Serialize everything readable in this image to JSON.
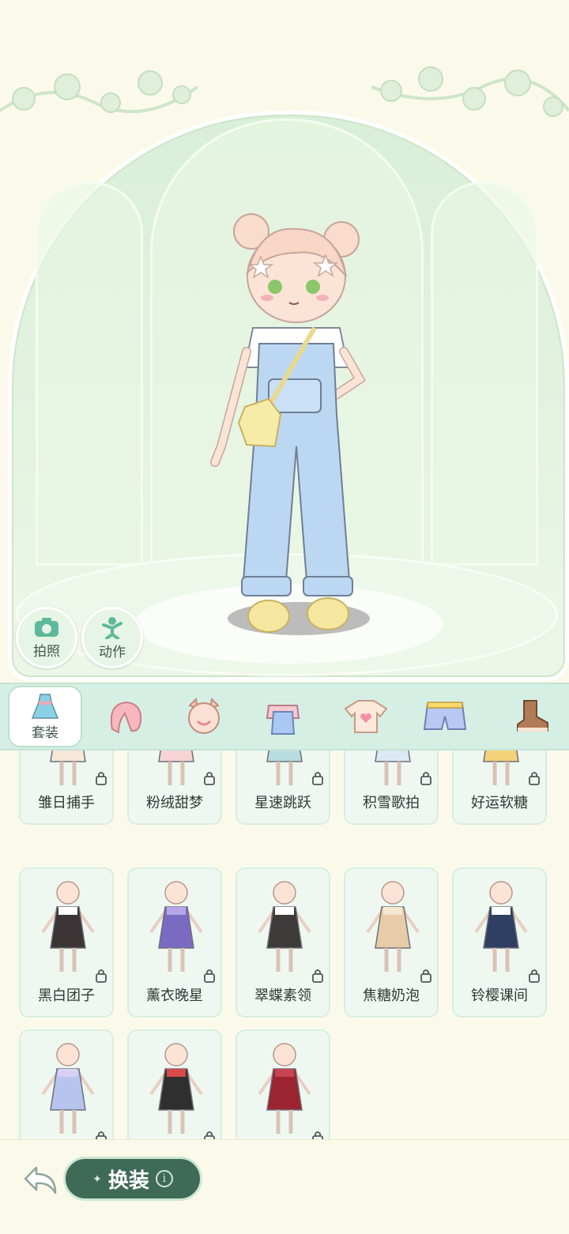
{
  "stage": {
    "photo_button_label": "拍照",
    "action_button_label": "动作"
  },
  "tabs": {
    "active_label": "套装",
    "icons": [
      "dress-icon",
      "hair-icon",
      "face-icon",
      "overalls-icon",
      "tshirt-icon",
      "shorts-icon",
      "shoe-icon"
    ]
  },
  "outfits": [
    {
      "name": "雏日捕手",
      "locked": true,
      "colors": [
        "#f6e7d8",
        "#ffffff"
      ]
    },
    {
      "name": "粉绒甜梦",
      "locked": true,
      "colors": [
        "#f7d3d6",
        "#ffffff"
      ]
    },
    {
      "name": "星速跳跃",
      "locked": true,
      "colors": [
        "#b9dcdf",
        "#8fc7cc"
      ]
    },
    {
      "name": "积雪歌拍",
      "locked": true,
      "colors": [
        "#dbe9f2",
        "#ffffff"
      ]
    },
    {
      "name": "好运软糖",
      "locked": true,
      "colors": [
        "#f4d27a",
        "#ffffff"
      ]
    },
    {
      "name": "黑白团子",
      "locked": true,
      "colors": [
        "#3b3536",
        "#ffffff"
      ]
    },
    {
      "name": "薰衣晚星",
      "locked": true,
      "colors": [
        "#7b6ac2",
        "#b6a8e6"
      ]
    },
    {
      "name": "翠蝶素领",
      "locked": true,
      "colors": [
        "#3e3a3a",
        "#ffffff"
      ]
    },
    {
      "name": "焦糖奶泡",
      "locked": true,
      "colors": [
        "#e8cba7",
        "#f6e7d1"
      ]
    },
    {
      "name": "铃樱课间",
      "locked": true,
      "colors": [
        "#2f3f63",
        "#ffffff"
      ]
    },
    {
      "name": "",
      "locked": true,
      "colors": [
        "#b7c4ee",
        "#d9d0f4"
      ]
    },
    {
      "name": "",
      "locked": true,
      "colors": [
        "#2f2f2f",
        "#d94a4a"
      ]
    },
    {
      "name": "",
      "locked": true,
      "colors": [
        "#9c2430",
        "#c94452"
      ]
    }
  ],
  "bottom": {
    "swap_label": "换装",
    "info_symbol": "i"
  }
}
